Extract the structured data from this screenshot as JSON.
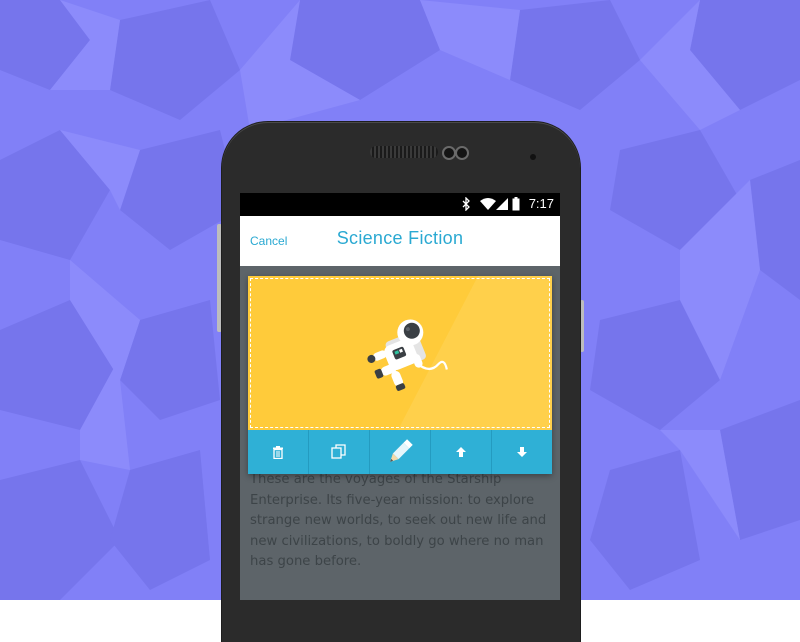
{
  "colors": {
    "background": "#8180f7",
    "accent": "#2aa9d2",
    "image_fill": "#ffcb3a",
    "toolbar": "#2fb0d6",
    "screen_dim": "#5d6469"
  },
  "status_bar": {
    "time": "7:17",
    "icons": [
      "bluetooth-icon",
      "wifi-icon",
      "signal-icon",
      "battery-icon"
    ]
  },
  "app_bar": {
    "cancel_label": "Cancel",
    "title": "Science Fiction"
  },
  "image_card": {
    "illustration": "astronaut-icon",
    "toolbar": [
      {
        "name": "delete",
        "icon": "trash-icon"
      },
      {
        "name": "duplicate",
        "icon": "copy-icon"
      },
      {
        "name": "edit",
        "icon": "pencil-icon"
      },
      {
        "name": "move-up",
        "icon": "arrow-up-icon"
      },
      {
        "name": "move-down",
        "icon": "arrow-down-icon"
      }
    ]
  },
  "body_text": "These are the voyages of the Starship Enterprise. Its five-year mission: to explore strange new worlds, to seek out new life and new civilizations, to boldly go where no man has gone before."
}
